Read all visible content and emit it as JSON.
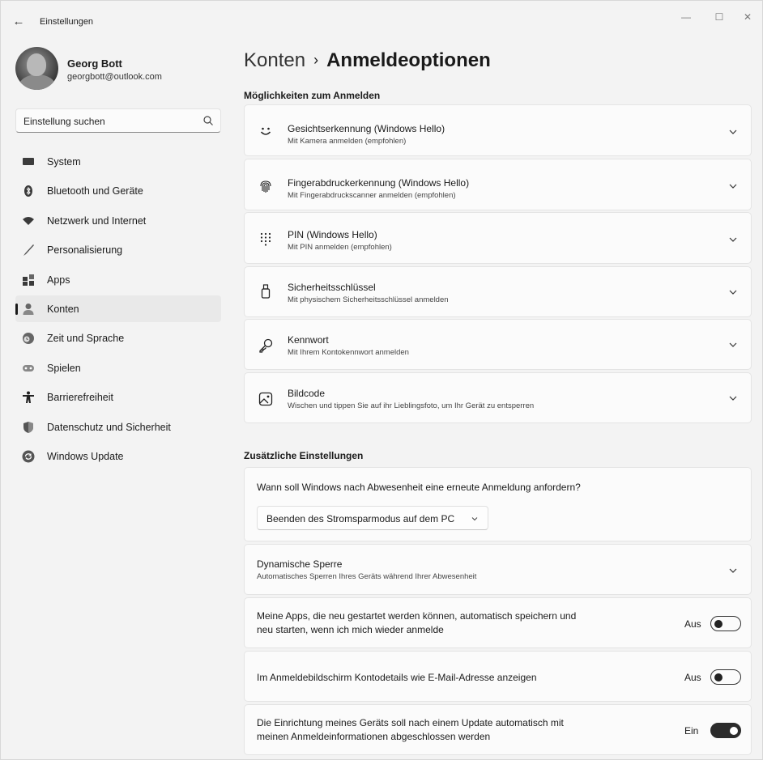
{
  "window": {
    "title": "Einstellungen",
    "back": "←",
    "min": "—",
    "max": "☐",
    "close": "✕"
  },
  "profile": {
    "name": "Georg Bott",
    "email": "georgbott@outlook.com"
  },
  "search": {
    "placeholder": "Einstellung suchen",
    "icon": "search-icon"
  },
  "nav": {
    "items": [
      {
        "label": "System",
        "icon": "monitor-icon"
      },
      {
        "label": "Bluetooth und Geräte",
        "icon": "bluetooth-icon"
      },
      {
        "label": "Netzwerk und Internet",
        "icon": "wifi-icon"
      },
      {
        "label": "Personalisierung",
        "icon": "brush-icon"
      },
      {
        "label": "Apps",
        "icon": "apps-icon"
      },
      {
        "label": "Konten",
        "icon": "person-icon",
        "active": true
      },
      {
        "label": "Zeit und Sprache",
        "icon": "clock-globe-icon"
      },
      {
        "label": "Spielen",
        "icon": "gamepad-icon"
      },
      {
        "label": "Barrierefreiheit",
        "icon": "accessibility-icon"
      },
      {
        "label": "Datenschutz und Sicherheit",
        "icon": "shield-icon"
      },
      {
        "label": "Windows Update",
        "icon": "update-icon"
      }
    ]
  },
  "page": {
    "breadcrumb_parent": "Konten",
    "breadcrumb_sep": "›",
    "title": "Anmeldeoptionen"
  },
  "signin_section": {
    "title": "Möglichkeiten zum Anmelden",
    "options": [
      {
        "title": "Gesichtserkennung (Windows Hello)",
        "subtitle": "Mit Kamera anmelden (empfohlen)",
        "icon": "face-icon"
      },
      {
        "title": "Fingerabdruckerkennung (Windows Hello)",
        "subtitle": "Mit Fingerabdruckscanner anmelden (empfohlen)",
        "icon": "fingerprint-icon"
      },
      {
        "title": "PIN (Windows Hello)",
        "subtitle": "Mit PIN anmelden (empfohlen)",
        "icon": "keypad-icon"
      },
      {
        "title": "Sicherheitsschlüssel",
        "subtitle": "Mit physischem Sicherheitsschlüssel anmelden",
        "icon": "usb-key-icon"
      },
      {
        "title": "Kennwort",
        "subtitle": "Mit Ihrem Kontokennwort anmelden",
        "icon": "key-icon"
      },
      {
        "title": "Bildcode",
        "subtitle": "Wischen und tippen Sie auf ihr Lieblingsfoto, um Ihr Gerät zu entsperren",
        "icon": "picture-icon"
      }
    ]
  },
  "additional_section": {
    "title": "Zusätzliche Einstellungen",
    "reauth": {
      "question": "Wann soll Windows nach Abwesenheit eine erneute Anmeldung anfordern?",
      "selected": "Beenden des Stromsparmodus auf dem PC"
    },
    "dynamic_lock": {
      "title": "Dynamische Sperre",
      "subtitle": "Automatisches Sperren Ihres Geräts während Ihrer Abwesenheit"
    },
    "restart_apps": {
      "line1": "Meine Apps, die neu gestartet werden können, automatisch speichern und",
      "line2": "neu starten, wenn ich mich wieder anmelde",
      "state_label": "Aus",
      "on": false
    },
    "account_details": {
      "text": "Im Anmeldebildschirm Kontodetails wie E-Mail-Adresse anzeigen",
      "state_label": "Aus",
      "on": false
    },
    "finish_setup": {
      "line1": "Die Einrichtung meines Geräts soll nach einem Update automatisch mit",
      "line2": "meinen Anmeldeinformationen abgeschlossen werden",
      "state_label": "Ein",
      "on": true
    }
  }
}
